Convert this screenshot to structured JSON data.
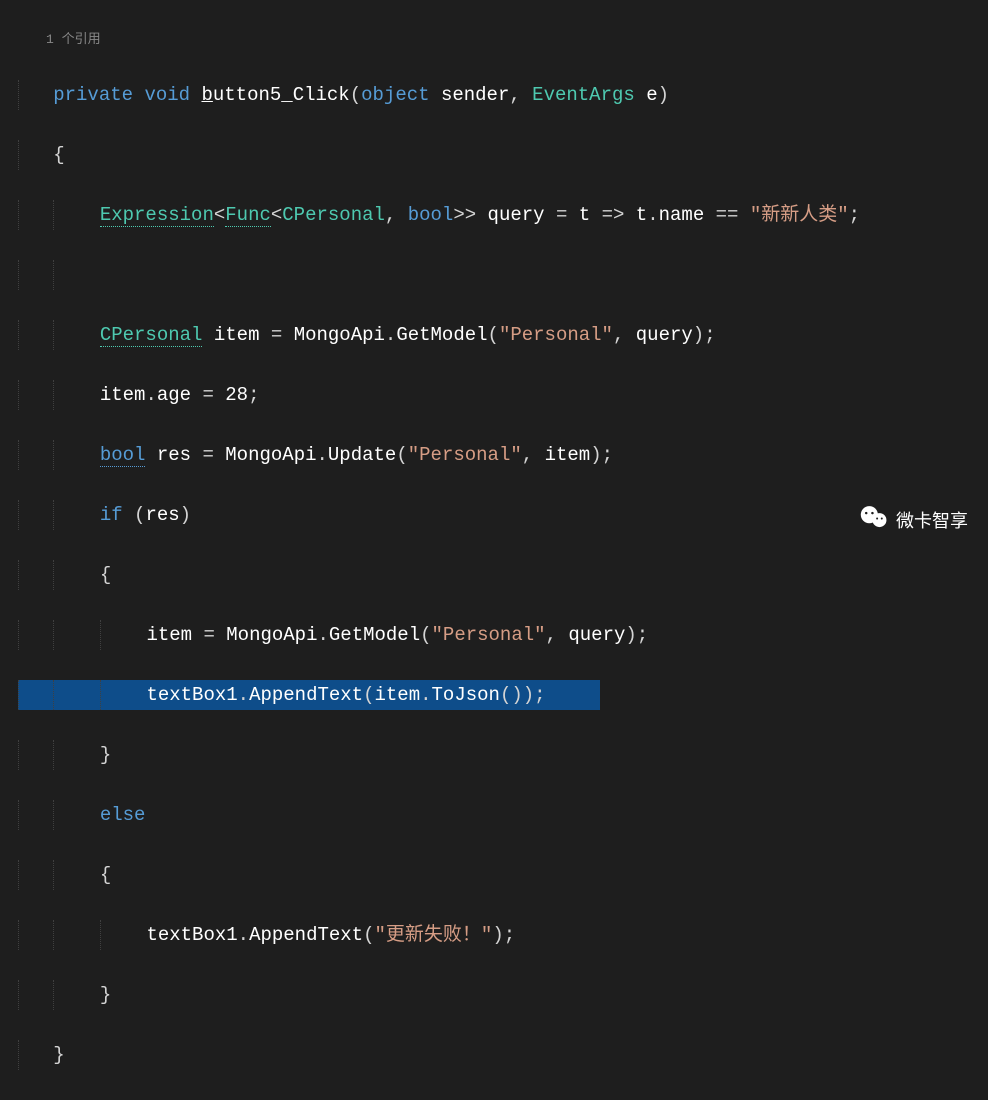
{
  "codelens": "1 个引用",
  "code": {
    "kw_private": "private",
    "kw_void": "void",
    "method_name": "button5_Click",
    "hotkey_char": "b",
    "method_rest": "utton5_Click",
    "kw_object": "object",
    "param_sender": "sender",
    "type_eventargs": "EventArgs",
    "param_e": "e",
    "type_expression": "Expression",
    "type_func": "Func",
    "type_cpersonal": "CPersonal",
    "kw_bool": "bool",
    "var_query": "query",
    "var_t": "t",
    "prop_name": "name",
    "str_name": "\"新新人类\"",
    "var_item": "item",
    "type_mongoapi": "MongoApi",
    "method_getmodel": "GetModel",
    "str_personal": "\"Personal\"",
    "prop_age": "age",
    "num_28": "28",
    "var_res": "res",
    "method_update": "Update",
    "kw_if": "if",
    "kw_else": "else",
    "var_textbox": "textBox1",
    "method_appendtext": "AppendText",
    "method_tojson": "ToJson",
    "str_fail": "\"更新失败！\""
  },
  "watermark": "微卡智享"
}
